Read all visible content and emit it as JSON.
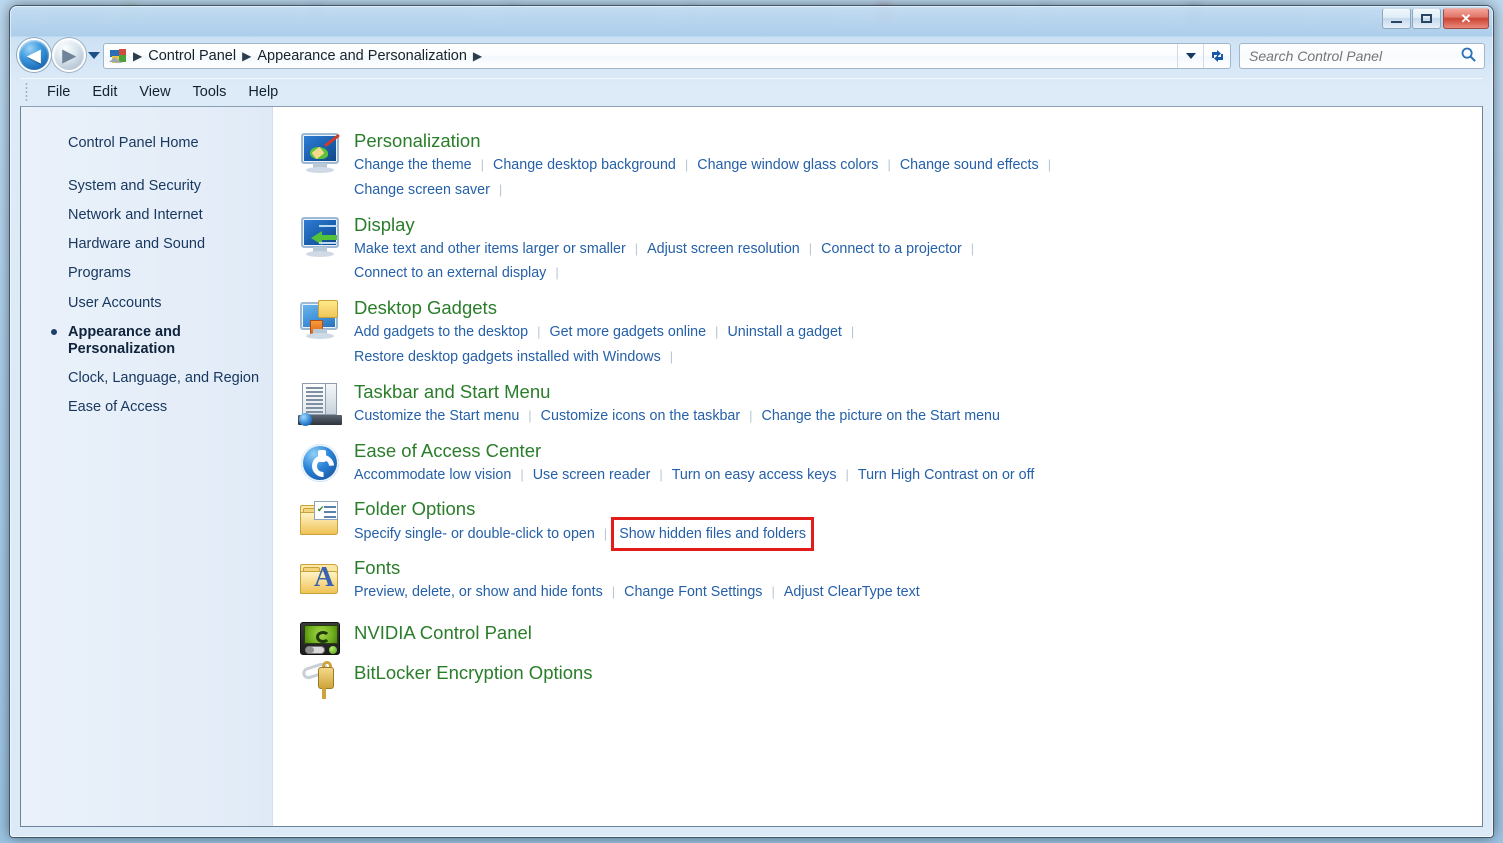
{
  "window": {
    "controls": {
      "minimize": "Minimize",
      "maximize": "Maximize",
      "close": "Close",
      "close_glyph": "✕"
    }
  },
  "navbar": {
    "back_label": "Back",
    "back_glyph": "◀",
    "forward_label": "Forward",
    "forward_glyph": "▶",
    "recent_pages_label": "Recent pages",
    "breadcrumb": [
      "Control Panel",
      "Appearance and Personalization"
    ],
    "breadcrumb_separator": "▶",
    "previous_locations_label": "Previous locations",
    "refresh_label": "Refresh",
    "refresh_glyph": "↻"
  },
  "search": {
    "placeholder": "Search Control Panel",
    "value": "",
    "icon_glyph": "⌕"
  },
  "menubar": {
    "items": [
      "File",
      "Edit",
      "View",
      "Tools",
      "Help"
    ]
  },
  "sidebar": {
    "home": "Control Panel Home",
    "items": [
      {
        "label": "System and Security",
        "current": false
      },
      {
        "label": "Network and Internet",
        "current": false
      },
      {
        "label": "Hardware and Sound",
        "current": false
      },
      {
        "label": "Programs",
        "current": false
      },
      {
        "label": "User Accounts",
        "current": false
      },
      {
        "label": "Appearance and Personalization",
        "current": true
      },
      {
        "label": "Clock, Language, and Region",
        "current": false
      },
      {
        "label": "Ease of Access",
        "current": false
      }
    ]
  },
  "content": {
    "groups": [
      {
        "id": "personalization",
        "title": "Personalization",
        "icon": "personalization-icon",
        "links": [
          "Change the theme",
          "Change desktop background",
          "Change window glass colors",
          "Change sound effects",
          "Change screen saver"
        ],
        "row_break_after": 4,
        "trailing_separator": true
      },
      {
        "id": "display",
        "title": "Display",
        "icon": "display-icon",
        "links": [
          "Make text and other items larger or smaller",
          "Adjust screen resolution",
          "Connect to a projector",
          "Connect to an external display"
        ],
        "row_break_after": 3,
        "trailing_separator": true
      },
      {
        "id": "desktop-gadgets",
        "title": "Desktop Gadgets",
        "icon": "desktop-gadgets-icon",
        "links": [
          "Add gadgets to the desktop",
          "Get more gadgets online",
          "Uninstall a gadget",
          "Restore desktop gadgets installed with Windows"
        ],
        "row_break_after": 3,
        "trailing_separator": true
      },
      {
        "id": "taskbar-and-start-menu",
        "title": "Taskbar and Start Menu",
        "icon": "taskbar-icon",
        "links": [
          "Customize the Start menu",
          "Customize icons on the taskbar",
          "Change the picture on the Start menu"
        ],
        "row_break_after": null,
        "trailing_separator": false
      },
      {
        "id": "ease-of-access-center",
        "title": "Ease of Access Center",
        "icon": "ease-of-access-icon",
        "links": [
          "Accommodate low vision",
          "Use screen reader",
          "Turn on easy access keys",
          "Turn High Contrast on or off"
        ],
        "row_break_after": null,
        "trailing_separator": false
      },
      {
        "id": "folder-options",
        "title": "Folder Options",
        "icon": "folder-options-icon",
        "links": [
          "Specify single- or double-click to open",
          "Show hidden files and folders"
        ],
        "highlighted_link": "Show hidden files and folders",
        "row_break_after": null,
        "trailing_separator": false
      },
      {
        "id": "fonts",
        "title": "Fonts",
        "icon": "fonts-icon",
        "links": [
          "Preview, delete, or show and hide fonts",
          "Change Font Settings",
          "Adjust ClearType text"
        ],
        "row_break_after": null,
        "trailing_separator": false
      },
      {
        "id": "nvidia-control-panel",
        "title": "NVIDIA Control Panel",
        "icon": "nvidia-icon",
        "links": [],
        "row_break_after": null,
        "trailing_separator": false
      },
      {
        "id": "bitlocker-encryption-options",
        "title": "BitLocker Encryption Options",
        "icon": "bitlocker-icon",
        "links": [],
        "row_break_after": null,
        "trailing_separator": false
      }
    ]
  },
  "colors": {
    "heading_green": "#2a7d2a",
    "link_blue": "#2560a8",
    "highlight_red": "#e21b1b",
    "sidebar_text": "#17375e",
    "sidebar_bg": "#e4edf8"
  }
}
